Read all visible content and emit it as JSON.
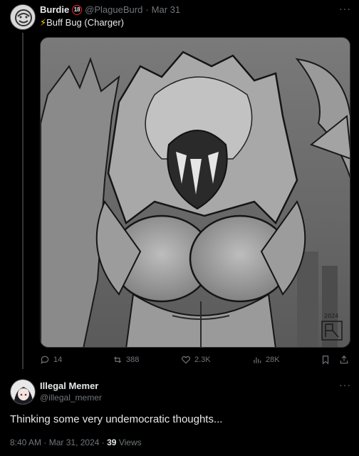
{
  "post": {
    "author_name": "Burdie",
    "age_badge": "18",
    "handle": "@PlagueBurd",
    "separator": "·",
    "date": "Mar 31",
    "text_icon": "lightning-bolt-icon",
    "text": "Buff Bug (Charger)",
    "media_signature": "2024",
    "actions": {
      "replies": "14",
      "reposts": "388",
      "likes": "2.3K",
      "views": "28K"
    },
    "more_label": "···"
  },
  "reply": {
    "author_name": "Illegal Memer",
    "handle": "@illegal_memer",
    "text": "Thinking some very undemocratic thoughts...",
    "time": "8:40 AM",
    "date": "Mar 31, 2024",
    "separator": "·",
    "views_count": "39",
    "views_label": "Views",
    "more_label": "···"
  },
  "colors": {
    "background": "#000000",
    "text": "#e7e9ea",
    "muted": "#71767b",
    "badge_red": "#f4212e"
  }
}
